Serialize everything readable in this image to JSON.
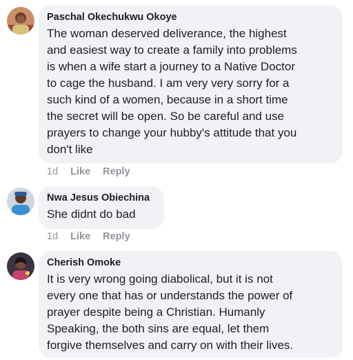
{
  "comments": [
    {
      "author": "Paschal Okechukwu Okoye",
      "text": "The woman deserved deliverance, the highest\nand easiest way to create a family into problems\nis when a wife start a journey to a Native Doctor\nto cage the husband. I am very very sorry for a\nsuch kind of a women, because in a short time\nthe secret will be open. So be careful and use\nprayers to change your hubby's attitude that you\ndon't like",
      "time": "1d",
      "like_label": "Like",
      "reply_label": "Reply"
    },
    {
      "author": "Nwa Jesus Obiechina",
      "text": "She didnt do bad",
      "time": "1d",
      "like_label": "Like",
      "reply_label": "Reply"
    },
    {
      "author": "Cherish Omoke",
      "text": "It is very wrong going diabolical, but it is not\nevery one that has or understands the power of\nprayer despite being a Christian. Humanly\nSpeaking, the both sins are equal,  let them\nforgive themselves and carry on with their lives.",
      "time": "",
      "like_label": "",
      "reply_label": ""
    }
  ]
}
